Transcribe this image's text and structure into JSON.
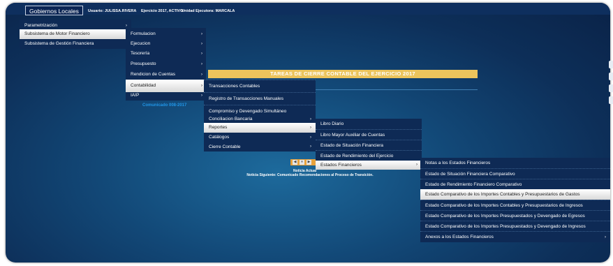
{
  "header": {
    "brand": "Gobiernos Locales",
    "user": "Usuario: JULISSA.RIVERA",
    "ejercicio": "Ejercicio 2017, ACTIVO",
    "unidad": "Unidad Ejecutora: MARCALA"
  },
  "menu1": {
    "items": [
      "Parametrización",
      "Subsistema de Motor Financiero",
      "Subsistema de Gestión Financiera"
    ],
    "highlighted": "Subsistema de Motor Financiero"
  },
  "menu2": {
    "items": [
      "Formulacion",
      "Ejecucion",
      "Tesorería",
      "Presupuesto",
      "Rendicion de Cuentas",
      "Contabilidad",
      "IAIP"
    ],
    "highlighted": "Contabilidad"
  },
  "menu3": {
    "items": [
      "Transacciones Contables",
      "Registro de Transacciones Manuales",
      "Compromiso y Devengado Simultáneo",
      "Conciliacion Bancaria",
      "Reportes",
      "Catálogos",
      "Cierre Contable"
    ],
    "highlighted": "Reportes"
  },
  "menu4": {
    "items": [
      "Libro Diario",
      "Libro Mayor Auxiliar de Cuentas",
      "Estado de Situación Financiera",
      "Estado de Rendimiento del Ejercicio",
      "Estados Financieros"
    ],
    "highlighted": "Estados Financieros"
  },
  "menu5": {
    "items": [
      "Notas a los Estados Financieros",
      "Estado de Situación Financiera Comparativo",
      "Estado de Rendimiento Financiero Comparativo",
      "Estado Comparativo de los Importes Contables y Presupuestarios de Gastos",
      "Estado Comparativo de los Importes Contables y Presupuestarios de Ingresos",
      "Estado Comparativo de los Importes Presupuestados y Devengado de Egresos",
      "Estado Comparativo de los Importes Presupuestados y Devengado de Ingresos",
      "Anexos a los Estados Financieros"
    ],
    "highlighted": "Estado Comparativo de los Importes Contables y Presupuestarios de Gastos"
  },
  "main": {
    "banner": "TAREAS DE CIERRE CONTABLE DEL EJERCICIO 2017",
    "comunicado": "Comunicado 008-2017",
    "noticia_actual": "Noticia Actual",
    "noticia_siguiente": "Noticia Siguiente: Comunicado Recomendaciones al Proceso de Transición.",
    "pager": [
      "◀",
      "⏸",
      "▶"
    ]
  },
  "colors": {
    "banner": "#ecc45c",
    "menu_bg": "#0e2a55",
    "highlight": "#ffffff",
    "comunicado": "#2196e8"
  },
  "icons": {
    "submenu_arrow": "chevron-right-icon"
  }
}
